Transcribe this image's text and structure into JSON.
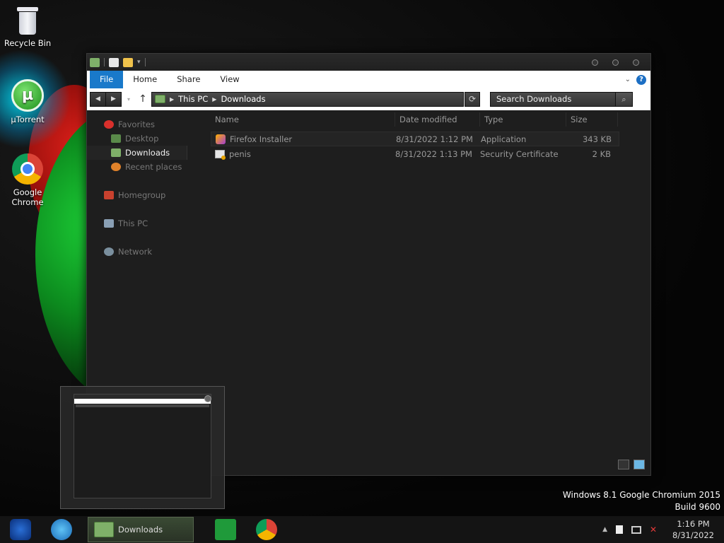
{
  "desktop": {
    "icons": [
      {
        "label": "Recycle Bin"
      },
      {
        "label": "µTorrent"
      },
      {
        "label": "Google Chrome"
      }
    ],
    "watermark": {
      "line1": "Windows 8.1 Google Chromium 2015",
      "line2": "Build 9600"
    }
  },
  "explorer": {
    "ribbon": {
      "tabs": [
        "File",
        "Home",
        "Share",
        "View"
      ]
    },
    "address": {
      "crumbs": [
        "This PC",
        "Downloads"
      ]
    },
    "search": {
      "placeholder": "Search Downloads"
    },
    "nav": {
      "favorites": "Favorites",
      "desktop": "Desktop",
      "downloads": "Downloads",
      "recent": "Recent places",
      "homegroup": "Homegroup",
      "this_pc": "This PC",
      "network": "Network"
    },
    "columns": {
      "name": "Name",
      "date": "Date modified",
      "type": "Type",
      "size": "Size"
    },
    "files": [
      {
        "name": "Firefox Installer",
        "date": "8/31/2022 1:12 PM",
        "type": "Application",
        "size": "343 KB"
      },
      {
        "name": "penis",
        "date": "8/31/2022 1:13 PM",
        "type": "Security Certificate",
        "size": "2 KB"
      }
    ]
  },
  "taskbar": {
    "task_label": "Downloads",
    "clock": {
      "time": "1:16 PM",
      "date": "8/31/2022"
    }
  },
  "colors": {
    "file_tab": "#1979ca",
    "window_bg": "#1e1e1e",
    "taskbar_bg": "#141414"
  }
}
